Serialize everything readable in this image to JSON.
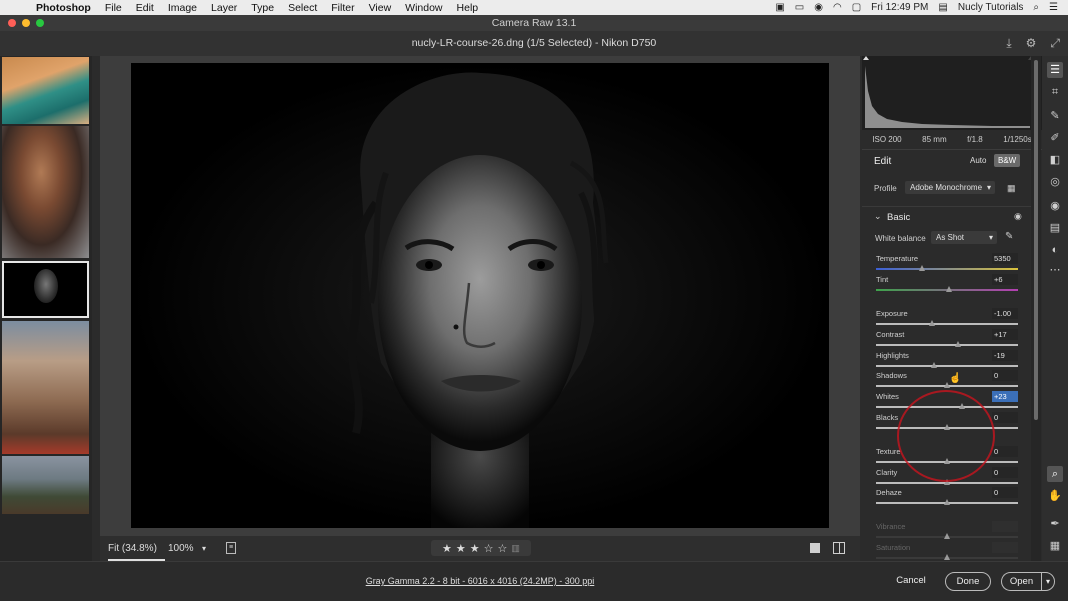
{
  "menubar": {
    "app_name": "Photoshop",
    "items": [
      "File",
      "Edit",
      "Image",
      "Layer",
      "Type",
      "Select",
      "Filter",
      "View",
      "Window",
      "Help"
    ],
    "clock": "Fri 12:49 PM",
    "user": "Nucly Tutorials"
  },
  "window": {
    "title": "Camera Raw 13.1",
    "file_title": "nucly-LR-course-26.dng (1/5 Selected)  -  Nikon D750"
  },
  "histogram": {
    "iso": "ISO 200",
    "focal": "85 mm",
    "aperture": "f/1.8",
    "shutter": "1/1250s"
  },
  "edit": {
    "title": "Edit",
    "auto_label": "Auto",
    "bw_label": "B&W",
    "profile_label": "Profile",
    "profile_value": "Adobe Monochrome",
    "basic_label": "Basic",
    "wb_label": "White balance",
    "wb_value": "As Shot"
  },
  "sliders": [
    {
      "name": "Temperature",
      "value": "5350",
      "pos": 0.33,
      "active": false,
      "dim": false
    },
    {
      "name": "Tint",
      "value": "+6",
      "pos": 0.52,
      "active": false,
      "dim": false
    },
    {
      "name": "Exposure",
      "value": "-1.00",
      "pos": 0.4,
      "active": false,
      "dim": false
    },
    {
      "name": "Contrast",
      "value": "+17",
      "pos": 0.58,
      "active": false,
      "dim": false
    },
    {
      "name": "Highlights",
      "value": "-19",
      "pos": 0.41,
      "active": false,
      "dim": false
    },
    {
      "name": "Shadows",
      "value": "0",
      "pos": 0.5,
      "active": false,
      "dim": false
    },
    {
      "name": "Whites",
      "value": "+23",
      "pos": 0.61,
      "active": true,
      "dim": false
    },
    {
      "name": "Blacks",
      "value": "0",
      "pos": 0.5,
      "active": false,
      "dim": false
    },
    {
      "name": "Texture",
      "value": "0",
      "pos": 0.5,
      "active": false,
      "dim": false
    },
    {
      "name": "Clarity",
      "value": "0",
      "pos": 0.5,
      "active": false,
      "dim": false
    },
    {
      "name": "Dehaze",
      "value": "0",
      "pos": 0.5,
      "active": false,
      "dim": false
    },
    {
      "name": "Vibrance",
      "value": "",
      "pos": 0.5,
      "active": false,
      "dim": true
    },
    {
      "name": "Saturation",
      "value": "",
      "pos": 0.5,
      "active": false,
      "dim": true
    }
  ],
  "zoombar": {
    "fit_label": "Fit (34.8%)",
    "zoom_value": "100%",
    "rating": 3
  },
  "footer": {
    "info": "Gray Gamma 2.2 - 8 bit - 6016 x 4016 (24.2MP) - 300 ppi",
    "cancel": "Cancel",
    "done": "Done",
    "open": "Open"
  }
}
